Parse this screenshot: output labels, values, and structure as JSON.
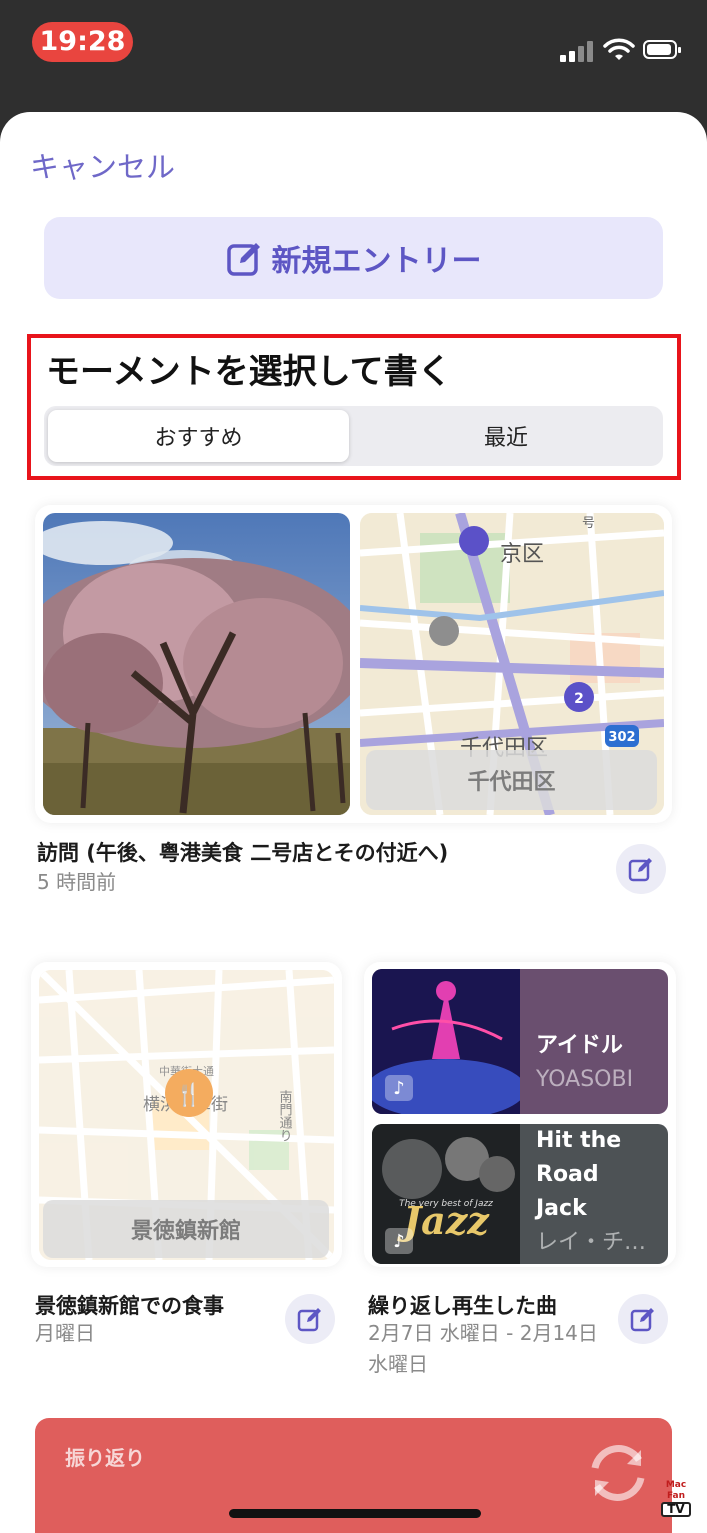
{
  "status_bar": {
    "time": "19:28"
  },
  "sheet": {
    "cancel_label": "キャンセル",
    "new_entry_label": "新規エントリー",
    "section_title": "モーメントを選択して書く",
    "tabs": [
      {
        "label": "おすすめ",
        "selected": true
      },
      {
        "label": "最近",
        "selected": false
      }
    ]
  },
  "cards": {
    "visit": {
      "map_label": "千代田区",
      "map_text": {
        "district_top": "京区",
        "district_bottom": "千代田区",
        "route": "302",
        "cluster": "2",
        "misc": "号"
      },
      "title": "訪問 (午後、粤港美食 二号店とその付近へ)",
      "subtitle": "5 時間前"
    },
    "meal": {
      "map_label": "景徳鎮新館",
      "map_text": {
        "area": "横浜中華街",
        "street": "南門通り",
        "road": "中華街大通"
      },
      "title": "景徳鎮新館での食事",
      "subtitle": "月曜日"
    },
    "songs": {
      "items": [
        {
          "title": "アイドル",
          "artist": "YOASOBI"
        },
        {
          "title": "Hit the Road Jack",
          "artist": "レイ・チ…"
        }
      ],
      "title": "繰り返し再生した曲",
      "subtitle": "2月7日 水曜日 - 2月14日 水曜日",
      "album_text": "The very best of Jazz"
    }
  },
  "reflection": {
    "label": "振り返り"
  },
  "watermark": {
    "line1": "Mac Fan",
    "line2": "TV"
  },
  "colors": {
    "accent": "#6f68c8",
    "highlight": "#e8141b",
    "reflection_bg": "#df5e5c"
  }
}
